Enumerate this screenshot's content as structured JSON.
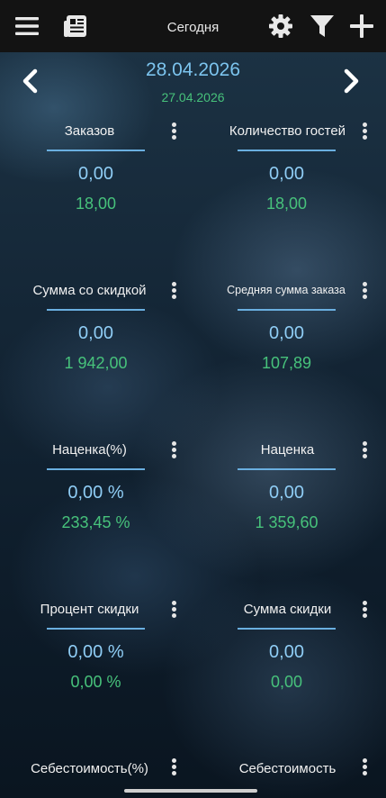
{
  "app": {
    "title": "Сегодня",
    "icons": [
      "menu-icon",
      "newspaper-icon",
      "gear-icon",
      "filter-icon",
      "plus-icon"
    ]
  },
  "date_nav": {
    "current": "28.04.2026",
    "previous": "27.04.2026"
  },
  "metrics": [
    {
      "label": "Заказов",
      "value": "0,00",
      "prev": "18,00"
    },
    {
      "label": "Количество гостей",
      "value": "0,00",
      "prev": "18,00"
    },
    {
      "label": "Сумма со скидкой",
      "value": "0,00",
      "prev": "1 942,00"
    },
    {
      "label": "Средняя сумма заказа",
      "value": "0,00",
      "prev": "107,89"
    },
    {
      "label": "Наценка(%)",
      "value": "0,00 %",
      "prev": "233,45 %"
    },
    {
      "label": "Наценка",
      "value": "0,00",
      "prev": "1 359,60"
    },
    {
      "label": "Процент скидки",
      "value": "0,00 %",
      "prev": "0,00 %"
    },
    {
      "label": "Сумма скидки",
      "value": "0,00",
      "prev": "0,00"
    },
    {
      "label": "Себестоимость(%)",
      "value": "",
      "prev": ""
    },
    {
      "label": "Себестоимость",
      "value": "",
      "prev": ""
    }
  ],
  "colors": {
    "accent": "#7cc4ee",
    "value": "#8fcdf5",
    "previous": "#47c27b",
    "topbar": "#131313"
  }
}
